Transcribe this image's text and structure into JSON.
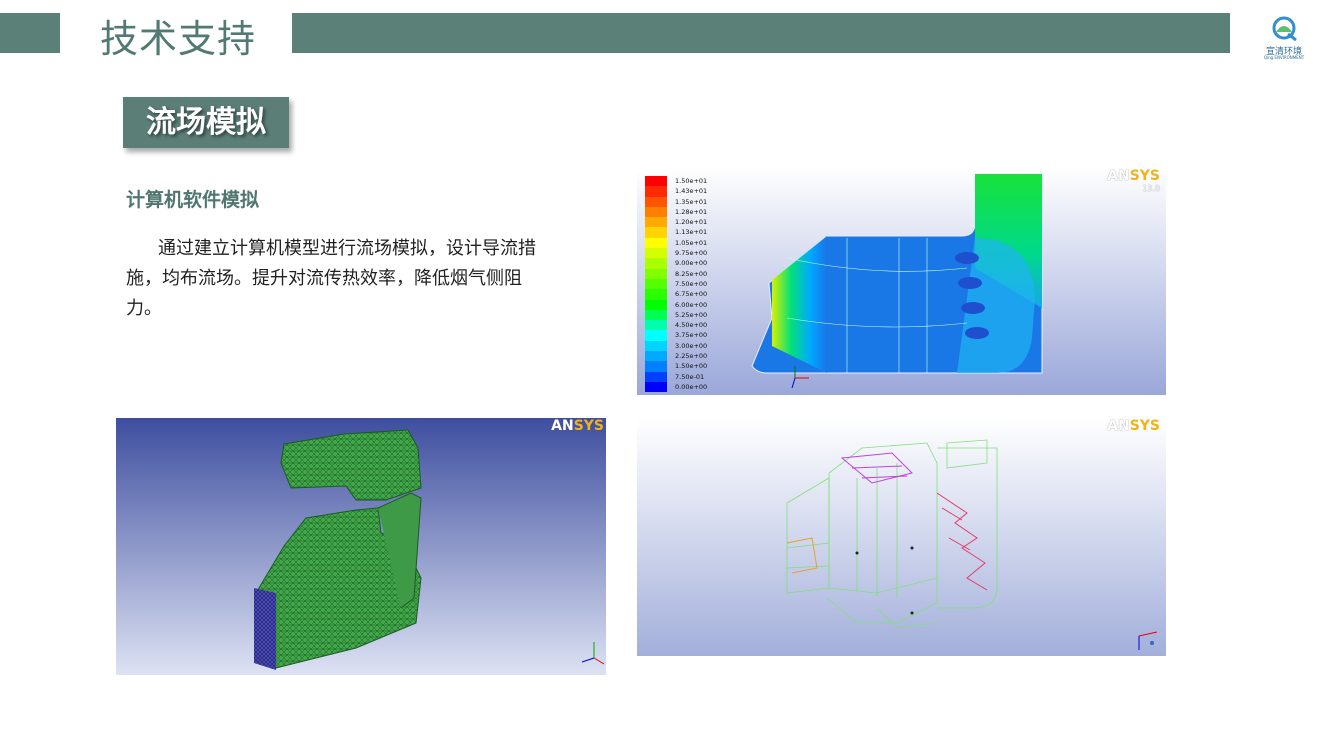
{
  "header": {
    "title": "技术支持"
  },
  "logo": {
    "name": "宣清环境",
    "sub": "Qing ENVIRONMENT"
  },
  "section": {
    "title": "流场模拟"
  },
  "content": {
    "subtitle": "计算机软件模拟",
    "body": "通过建立计算机模型进行流场模拟，设计导流措施，均布流场。提升对流传热效率，降低烟气侧阻力。"
  },
  "figures": {
    "contour": {
      "brand_a": "AN",
      "brand_b": "SYS",
      "version": "13.0",
      "legend": [
        {
          "label": "1.50e+01",
          "color": "#ff0000"
        },
        {
          "label": "1.43e+01",
          "color": "#ff2a00"
        },
        {
          "label": "1.35e+01",
          "color": "#ff5500"
        },
        {
          "label": "1.28e+01",
          "color": "#ff7f00"
        },
        {
          "label": "1.20e+01",
          "color": "#ffaa00"
        },
        {
          "label": "1.13e+01",
          "color": "#ffd400"
        },
        {
          "label": "1.05e+01",
          "color": "#ffff00"
        },
        {
          "label": "9.75e+00",
          "color": "#d4ff00"
        },
        {
          "label": "9.00e+00",
          "color": "#aaff00"
        },
        {
          "label": "8.25e+00",
          "color": "#7fff00"
        },
        {
          "label": "7.50e+00",
          "color": "#55ff00"
        },
        {
          "label": "6.75e+00",
          "color": "#2aff00"
        },
        {
          "label": "6.00e+00",
          "color": "#00ff00"
        },
        {
          "label": "5.25e+00",
          "color": "#00ff55"
        },
        {
          "label": "4.50e+00",
          "color": "#00ffaa"
        },
        {
          "label": "3.75e+00",
          "color": "#00ffff"
        },
        {
          "label": "3.00e+00",
          "color": "#00d4ff"
        },
        {
          "label": "2.25e+00",
          "color": "#00aaff"
        },
        {
          "label": "1.50e+00",
          "color": "#007fff"
        },
        {
          "label": "7.50e-01",
          "color": "#0040ff"
        },
        {
          "label": "0.00e+00",
          "color": "#0000ff"
        }
      ]
    },
    "mesh": {
      "brand_a": "AN",
      "brand_b": "SYS"
    },
    "wireframe": {
      "brand_a": "AN",
      "brand_b": "SYS"
    }
  }
}
